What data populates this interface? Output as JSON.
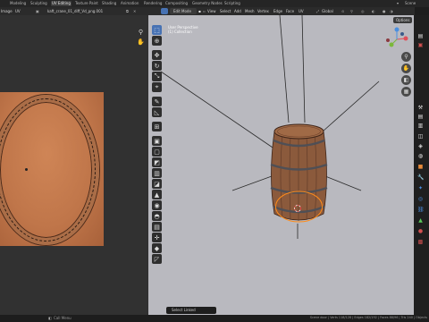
{
  "topbar": {
    "tabs": [
      "Modeling",
      "Sculpting",
      "UV Editing",
      "Texture Paint",
      "Shading",
      "Animation",
      "Rendering",
      "Compositing",
      "Geometry Nodes",
      "Scripting"
    ],
    "active_tab": "UV Editing",
    "scene_label": "Scene"
  },
  "uv_editor": {
    "mode_label": "Image",
    "uv_menu": "UV",
    "image_name": "kaft_crane_01_diff_Vd_png.001"
  },
  "viewport": {
    "mode_label": "Edit Mode",
    "menus": [
      "View",
      "Select",
      "Add",
      "Mesh",
      "Vertex",
      "Edge",
      "Face",
      "UV"
    ],
    "orientation": "Global",
    "options_label": "Options",
    "info_line1": "User Perspective",
    "info_line2": "(1) Collection"
  },
  "popup": {
    "label": "Select Linked"
  },
  "status": {
    "left_label": "Call Menu",
    "right_text": "Scene door | Verts 118/128 | Edges 182/192 | Faces 88/96 | Tris 240 | Objects"
  },
  "colors": {
    "accent": "#4772b3",
    "barrel_wood": "#8b5a3c",
    "selection": "#ff8c1a"
  }
}
